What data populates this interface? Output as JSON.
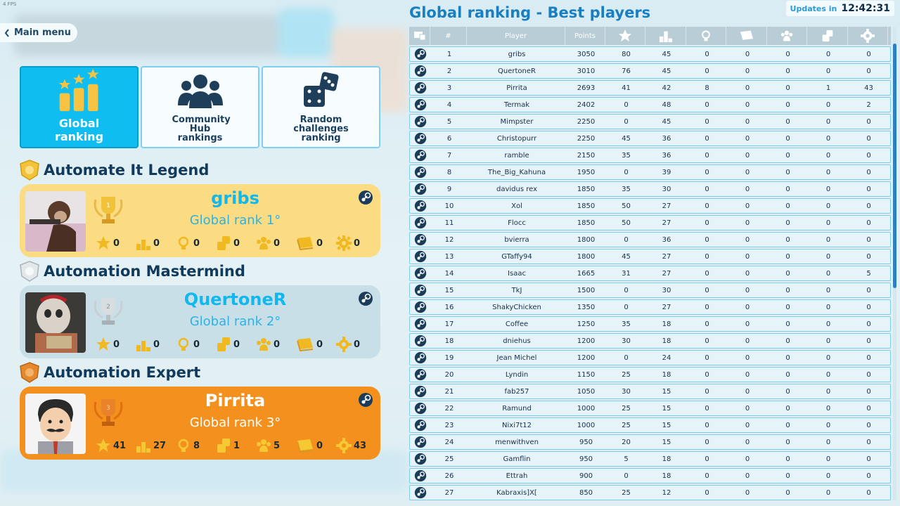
{
  "fps": "4 FPS",
  "main_menu": {
    "label": "Main menu"
  },
  "categories": [
    {
      "label": "Global ranking",
      "active": true,
      "icon": "stars-bars-icon"
    },
    {
      "label": "Community Hub rankings",
      "active": false,
      "icon": "people-icon"
    },
    {
      "label": "Random challenges ranking",
      "active": false,
      "icon": "dice-icon"
    }
  ],
  "featured": [
    {
      "tier": "Automate It Legend",
      "name": "gribs",
      "rank_text": "Global rank 1°",
      "stats": [
        "0",
        "0",
        "0",
        "0",
        "0",
        "0",
        "0"
      ],
      "colors": {
        "card": "#fbdc82",
        "medal": "#f2c23b"
      }
    },
    {
      "tier": "Automation Mastermind",
      "name": "QuertoneR",
      "rank_text": "Global rank 2°",
      "stats": [
        "0",
        "0",
        "0",
        "0",
        "0",
        "0",
        "0"
      ],
      "colors": {
        "card": "#c9dfe8",
        "medal": "#cdd4d8"
      }
    },
    {
      "tier": "Automation Expert",
      "name": "Pirrita",
      "rank_text": "Global rank 3°",
      "stats": [
        "41",
        "27",
        "8",
        "1",
        "5",
        "0",
        "43"
      ],
      "colors": {
        "card": "#f4901d",
        "medal": "#e58a2c"
      }
    }
  ],
  "stat_icons": [
    "star-icon",
    "podium-icon",
    "lightbulb-icon",
    "dice-icon",
    "people-icon",
    "book-icon",
    "gear-icon"
  ],
  "ranking": {
    "title": "Global ranking - Best players",
    "updates_label": "Updates in",
    "updates_time": "12:42:31",
    "headers": [
      "",
      "#",
      "Player",
      "Points",
      "",
      "",
      "",
      "",
      "",
      "",
      ""
    ],
    "header_icons": [
      "screen-icon",
      null,
      null,
      null,
      "star-icon",
      "podium-icon",
      "lightbulb-icon",
      "book-icon",
      "people-icon",
      "dice-icon",
      "gear-icon"
    ],
    "rows": [
      [
        "1",
        "gribs",
        "3050",
        "80",
        "45",
        "0",
        "0",
        "0",
        "0",
        "0"
      ],
      [
        "2",
        "QuertoneR",
        "3010",
        "76",
        "45",
        "0",
        "0",
        "0",
        "0",
        "0"
      ],
      [
        "3",
        "Pirrita",
        "2693",
        "41",
        "42",
        "8",
        "0",
        "0",
        "1",
        "43"
      ],
      [
        "4",
        "Termak",
        "2402",
        "0",
        "48",
        "0",
        "0",
        "0",
        "0",
        "2"
      ],
      [
        "5",
        "Mimpster",
        "2250",
        "0",
        "45",
        "0",
        "0",
        "0",
        "0",
        "0"
      ],
      [
        "6",
        "Christopurr",
        "2250",
        "45",
        "36",
        "0",
        "0",
        "0",
        "0",
        "0"
      ],
      [
        "7",
        "ramble",
        "2150",
        "35",
        "36",
        "0",
        "0",
        "0",
        "0",
        "0"
      ],
      [
        "8",
        "The_Big_Kahuna",
        "1950",
        "0",
        "39",
        "0",
        "0",
        "0",
        "0",
        "0"
      ],
      [
        "9",
        "davidus rex",
        "1850",
        "35",
        "30",
        "0",
        "0",
        "0",
        "0",
        "0"
      ],
      [
        "10",
        "Xol",
        "1850",
        "50",
        "27",
        "0",
        "0",
        "0",
        "0",
        "0"
      ],
      [
        "11",
        "Flocc",
        "1850",
        "50",
        "27",
        "0",
        "0",
        "0",
        "0",
        "0"
      ],
      [
        "12",
        "bvierra",
        "1800",
        "0",
        "36",
        "0",
        "0",
        "0",
        "0",
        "0"
      ],
      [
        "13",
        "GTaffy94",
        "1800",
        "45",
        "27",
        "0",
        "0",
        "0",
        "0",
        "0"
      ],
      [
        "14",
        "Isaac",
        "1665",
        "31",
        "27",
        "0",
        "0",
        "0",
        "0",
        "5"
      ],
      [
        "15",
        "TkJ",
        "1500",
        "0",
        "30",
        "0",
        "0",
        "0",
        "0",
        "0"
      ],
      [
        "16",
        "ShakyChicken",
        "1350",
        "0",
        "27",
        "0",
        "0",
        "0",
        "0",
        "0"
      ],
      [
        "17",
        "Coffee",
        "1250",
        "35",
        "18",
        "0",
        "0",
        "0",
        "0",
        "0"
      ],
      [
        "18",
        "dniehus",
        "1200",
        "30",
        "18",
        "0",
        "0",
        "0",
        "0",
        "0"
      ],
      [
        "19",
        "Jean Michel",
        "1200",
        "0",
        "24",
        "0",
        "0",
        "0",
        "0",
        "0"
      ],
      [
        "20",
        "Lyndin",
        "1150",
        "25",
        "18",
        "0",
        "0",
        "0",
        "0",
        "0"
      ],
      [
        "21",
        "fab257",
        "1050",
        "30",
        "15",
        "0",
        "0",
        "0",
        "0",
        "0"
      ],
      [
        "22",
        "Ramund",
        "1000",
        "25",
        "15",
        "0",
        "0",
        "0",
        "0",
        "0"
      ],
      [
        "23",
        "Nixi7t12",
        "1000",
        "25",
        "15",
        "0",
        "0",
        "0",
        "0",
        "0"
      ],
      [
        "24",
        "menwithven",
        "950",
        "20",
        "15",
        "0",
        "0",
        "0",
        "0",
        "0"
      ],
      [
        "25",
        "Gamflin",
        "950",
        "5",
        "18",
        "0",
        "0",
        "0",
        "0",
        "0"
      ],
      [
        "26",
        "Ettrah",
        "900",
        "0",
        "18",
        "0",
        "0",
        "0",
        "0",
        "0"
      ],
      [
        "27",
        "Kabraxis]X[",
        "850",
        "25",
        "12",
        "0",
        "0",
        "0",
        "0",
        "0"
      ]
    ]
  }
}
